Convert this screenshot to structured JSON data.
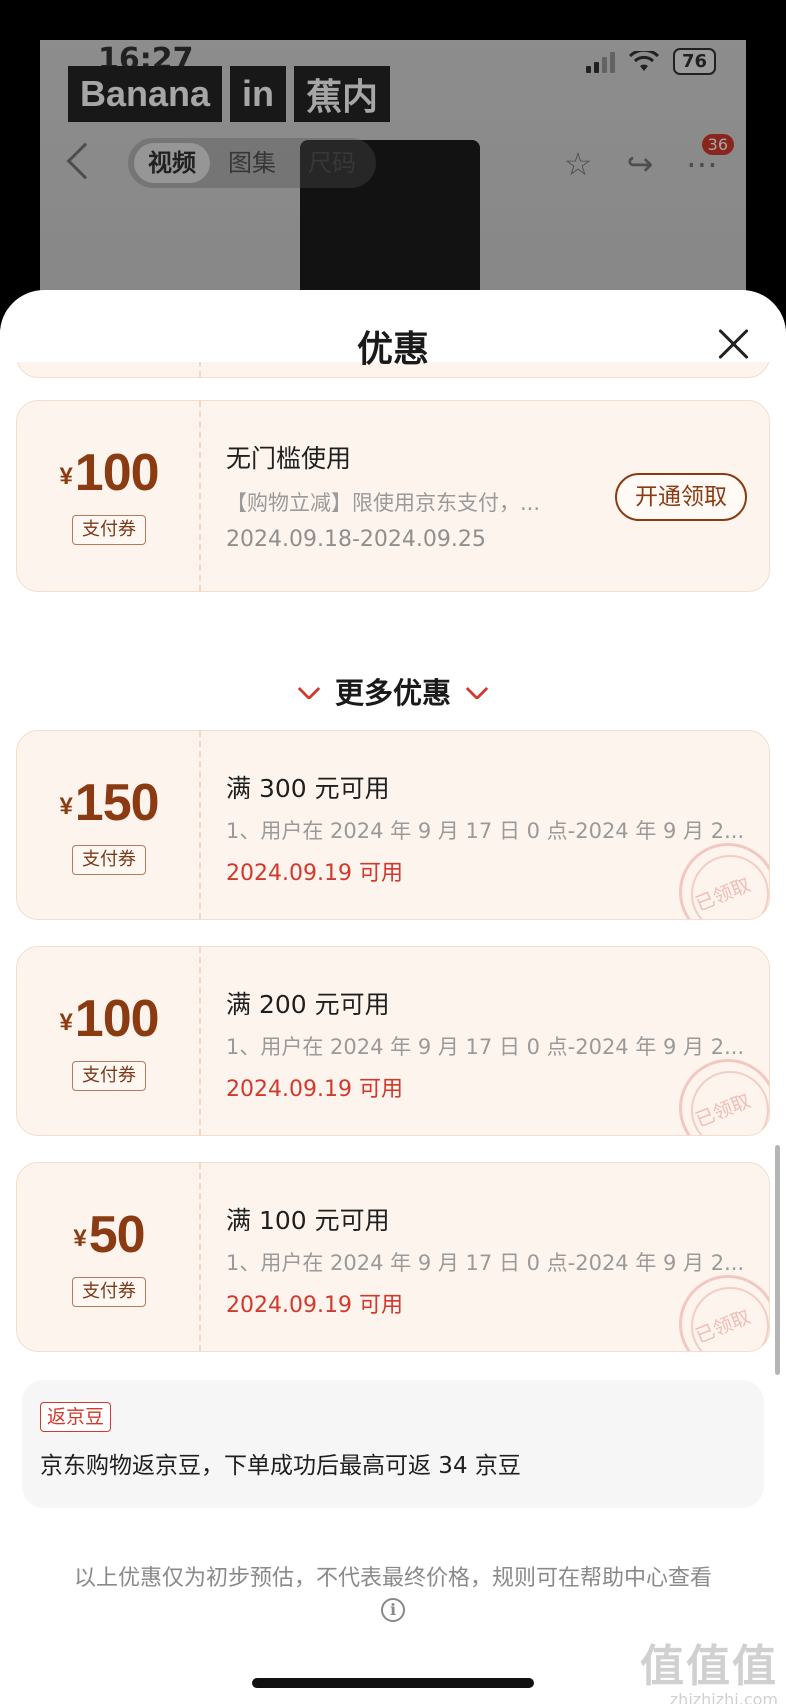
{
  "background": {
    "status_time": "16:27",
    "battery": "76",
    "brand": [
      "Banana",
      "in",
      "蕉内"
    ],
    "media_tabs": [
      "视频",
      "图集",
      "尺码"
    ],
    "badge_count": "36",
    "icons": [
      "back-icon",
      "star-icon",
      "share-icon",
      "more-icon"
    ]
  },
  "sheet": {
    "title": "优惠",
    "close_icon": "close-icon"
  },
  "top_coupon": {
    "currency": "¥",
    "amount": "100",
    "tag": "支付券",
    "title": "无门槛使用",
    "desc": "【购物立减】限使用京东支付，...",
    "date": "2024.09.18-2024.09.25",
    "button": "开通领取"
  },
  "more_heading": "更多优惠",
  "coupons": [
    {
      "currency": "¥",
      "amount": "150",
      "tag": "支付券",
      "title": "满 300 元可用",
      "desc": "1、用户在 2024 年 9 月 17 日 0 点-2024 年 9 月 2...",
      "date": "2024.09.19 可用",
      "stamp": "已领取"
    },
    {
      "currency": "¥",
      "amount": "100",
      "tag": "支付券",
      "title": "满 200 元可用",
      "desc": "1、用户在 2024 年 9 月 17 日 0 点-2024 年 9 月 2...",
      "date": "2024.09.19 可用",
      "stamp": "已领取"
    },
    {
      "currency": "¥",
      "amount": "50",
      "tag": "支付券",
      "title": "满 100 元可用",
      "desc": "1、用户在 2024 年 9 月 17 日 0 点-2024 年 9 月 2...",
      "date": "2024.09.19 可用",
      "stamp": "已领取"
    }
  ],
  "beans": {
    "tag": "返京豆",
    "text": "京东购物返京豆，下单成功后最高可返 34 京豆"
  },
  "disclaimer": "以上优惠仅为初步预估，不代表最终价格，规则可在帮助中心查看",
  "watermark": {
    "logo": "值值值",
    "url": "zhizhizhi.com"
  },
  "colors": {
    "coupon_bg": "#fdf4ee",
    "amount": "#8b3b12",
    "date_red": "#d1392c"
  }
}
